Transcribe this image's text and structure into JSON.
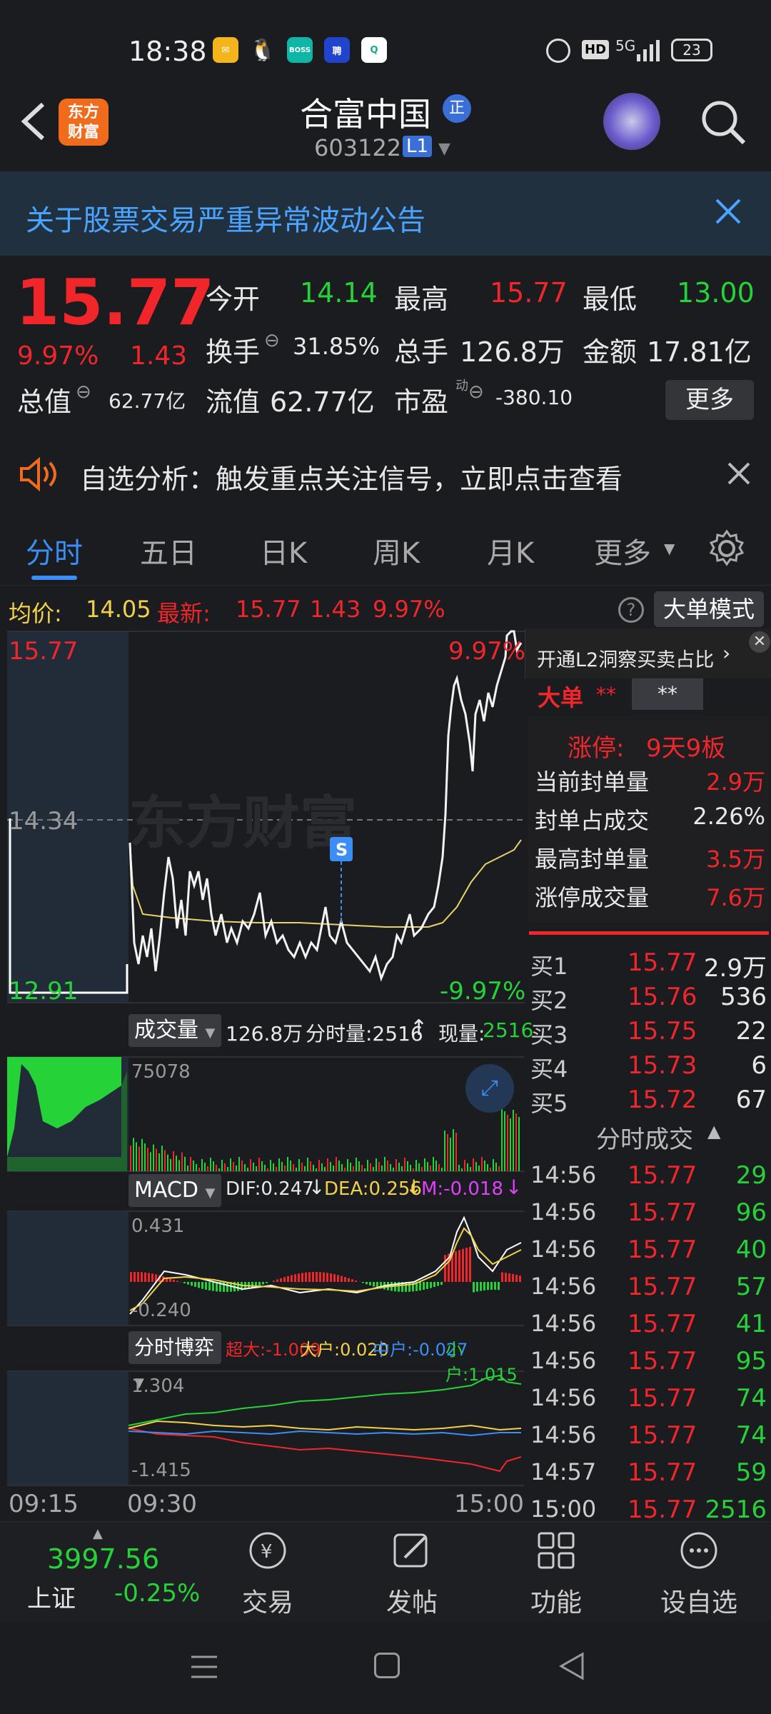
{
  "status": {
    "time": "18:38",
    "battery": "23",
    "network": "5G"
  },
  "header": {
    "brand": "东方\n财富",
    "stock_name": "合富中国",
    "stock_code": "603122",
    "level": "L1",
    "badge": "正"
  },
  "notice": {
    "text": "关于股票交易严重异常波动公告"
  },
  "quote": {
    "price": "15.77",
    "change_pct": "9.97%",
    "change": "1.43",
    "open_label": "今开",
    "open": "14.14",
    "high_label": "最高",
    "high": "15.77",
    "low_label": "最低",
    "low": "13.00",
    "turnover_label": "换手",
    "turnover": "31.85%",
    "volume_label": "总手",
    "volume": "126.8万",
    "amount_label": "金额",
    "amount": "17.81亿",
    "mcap_label": "总值",
    "mcap": "62.77亿",
    "float_label": "流值",
    "float_cap": "62.77亿",
    "pe_label": "市盈",
    "pe_sup": "动",
    "pe": "-380.10",
    "more_label": "更多"
  },
  "alert": {
    "text": "自选分析：触发重点关注信号，立即点击查看"
  },
  "tabs": [
    "分时",
    "五日",
    "日K",
    "周K",
    "月K",
    "更多"
  ],
  "avgbar": {
    "avg_label": "均价:",
    "avg": "14.05",
    "latest_label": "最新:",
    "latest": "15.77",
    "change": "1.43",
    "pct": "9.97%",
    "mode_btn": "大单模式"
  },
  "price_chart": {
    "top_price": "15.77",
    "top_pct": "9.97%",
    "mid_price": "14.34",
    "bottom_price": "12.91",
    "bottom_pct": "-9.97%",
    "watermark": "东方财富",
    "marker": "S"
  },
  "vol_panel": {
    "label": "成交量",
    "total": "126.8万",
    "tick_label": "分时量:2516",
    "now_label": "现量:",
    "now": "2516",
    "max": "75078"
  },
  "macd_panel": {
    "label": "MACD",
    "dif": "DIF:0.247",
    "dea": "DEA:0.256",
    "m": "M:-0.018",
    "top": "0.431",
    "bottom": "-0.240"
  },
  "game_panel": {
    "label": "分时博弈",
    "super": "超大:-1.009",
    "big": "大户:0.020",
    "mid": "中户:-0.027",
    "small": "小户:1.015",
    "top": "1.304",
    "bottom": "-1.415"
  },
  "time_axis": [
    "09:15",
    "09:30",
    "15:00"
  ],
  "right": {
    "l2_link": "开通L2洞察买卖占比",
    "big_label": "大单",
    "big_val": "**",
    "big_box": "**",
    "limit_label": "涨停:",
    "limit_val": "9天9板",
    "stats": [
      {
        "k": "当前封单量",
        "v": "2.9万",
        "c": "red"
      },
      {
        "k": "封单占成交",
        "v": "2.26%",
        "c": "white"
      },
      {
        "k": "最高封单量",
        "v": "3.5万",
        "c": "red"
      },
      {
        "k": "涨停成交量",
        "v": "7.6万",
        "c": "red"
      }
    ],
    "bids": [
      {
        "k": "买1",
        "p": "15.77",
        "v": "2.9万"
      },
      {
        "k": "买2",
        "p": "15.76",
        "v": "536"
      },
      {
        "k": "买3",
        "p": "15.75",
        "v": "22"
      },
      {
        "k": "买4",
        "p": "15.73",
        "v": "6"
      },
      {
        "k": "买5",
        "p": "15.72",
        "v": "67"
      }
    ],
    "trades_label": "分时成交",
    "trades": [
      {
        "t": "14:56",
        "p": "15.77",
        "v": "29"
      },
      {
        "t": "14:56",
        "p": "15.77",
        "v": "96"
      },
      {
        "t": "14:56",
        "p": "15.77",
        "v": "40"
      },
      {
        "t": "14:56",
        "p": "15.77",
        "v": "57"
      },
      {
        "t": "14:56",
        "p": "15.77",
        "v": "41"
      },
      {
        "t": "14:56",
        "p": "15.77",
        "v": "95"
      },
      {
        "t": "14:56",
        "p": "15.77",
        "v": "74"
      },
      {
        "t": "14:56",
        "p": "15.77",
        "v": "74"
      },
      {
        "t": "14:57",
        "p": "15.77",
        "v": "59"
      },
      {
        "t": "15:00",
        "p": "15.77",
        "v": "2516"
      }
    ]
  },
  "bottom": {
    "index_value": "3997.56",
    "index_name": "上证",
    "index_pct": "-0.25%",
    "trade": "交易",
    "post": "发帖",
    "func": "功能",
    "watch": "设自选"
  }
}
